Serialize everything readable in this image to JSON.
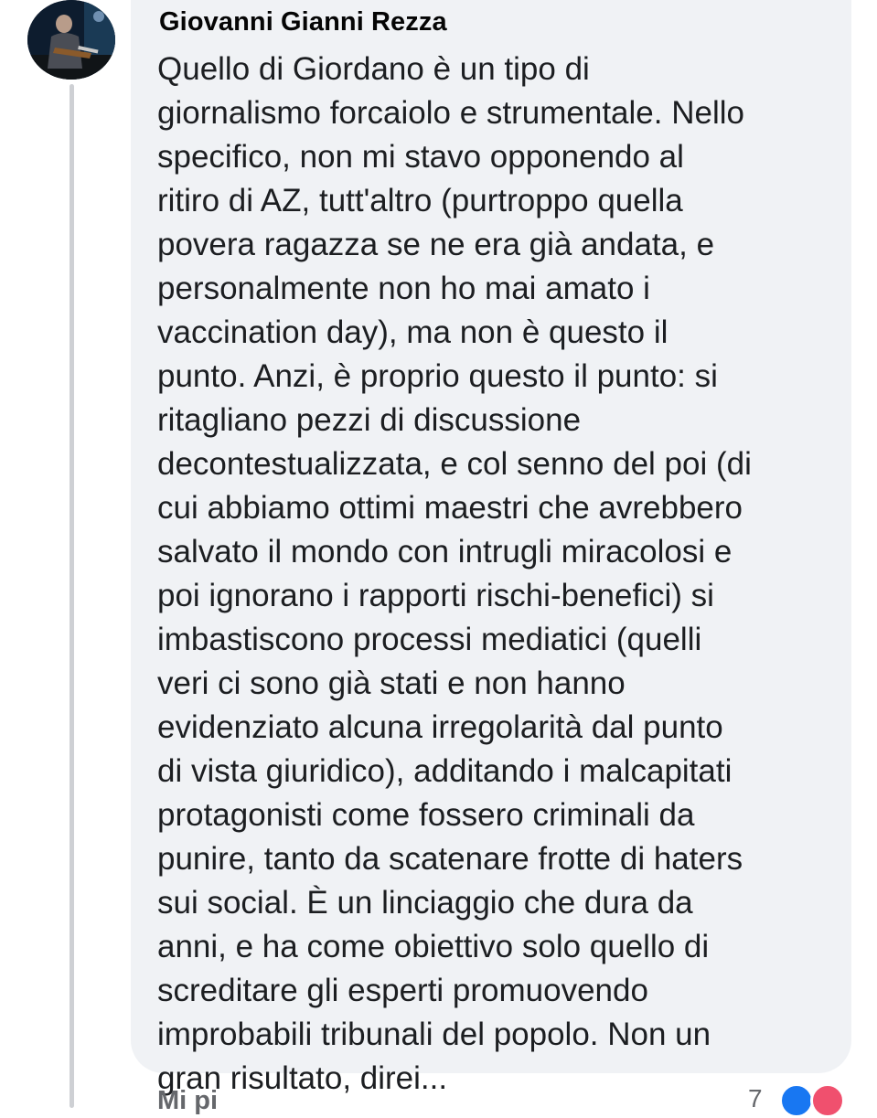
{
  "comment": {
    "author": "Giovanni Gianni Rezza",
    "text_lines": [
      "Quello di Giordano è un tipo di",
      "giornalismo forcaiolo e strumentale. Nello",
      "specifico, non mi stavo opponendo al",
      "ritiro di AZ, tutt'altro (purtroppo quella",
      "povera ragazza se ne era già andata, e",
      "personalmente non ho mai amato i",
      "vaccination day), ma non è questo il",
      "punto. Anzi, è proprio questo il punto: si",
      "ritagliano pezzi di discussione",
      "decontestualizzata, e col senno del poi (di",
      "cui abbiamo ottimi maestri che avrebbero",
      "salvato il mondo con intrugli miracolosi e",
      "poi ignorano i rapporti rischi-benefici) si",
      "imbastiscono processi mediatici (quelli",
      "veri ci sono già stati e non hanno",
      "evidenziato alcuna irregolarità dal punto",
      "di vista giuridico), additando i malcapitati",
      "protagonisti come fossero criminali da",
      "punire, tanto da scatenare frotte di haters",
      "sui social. È un linciaggio che dura da",
      "anni, e ha come obiettivo solo quello di",
      "screditare gli esperti promuovendo",
      "improbabili tribunali del popolo. Non un",
      "gran risultato, direi..."
    ]
  },
  "footer": {
    "action_label": "Mi pi",
    "reaction_count": "7",
    "reaction_icons": [
      "like-icon",
      "love-icon"
    ]
  },
  "colors": {
    "bubble": "#f0f2f5",
    "text": "#1c1e21",
    "secondary": "#65676b",
    "like": "#1877f2",
    "love": "#f0506e"
  }
}
